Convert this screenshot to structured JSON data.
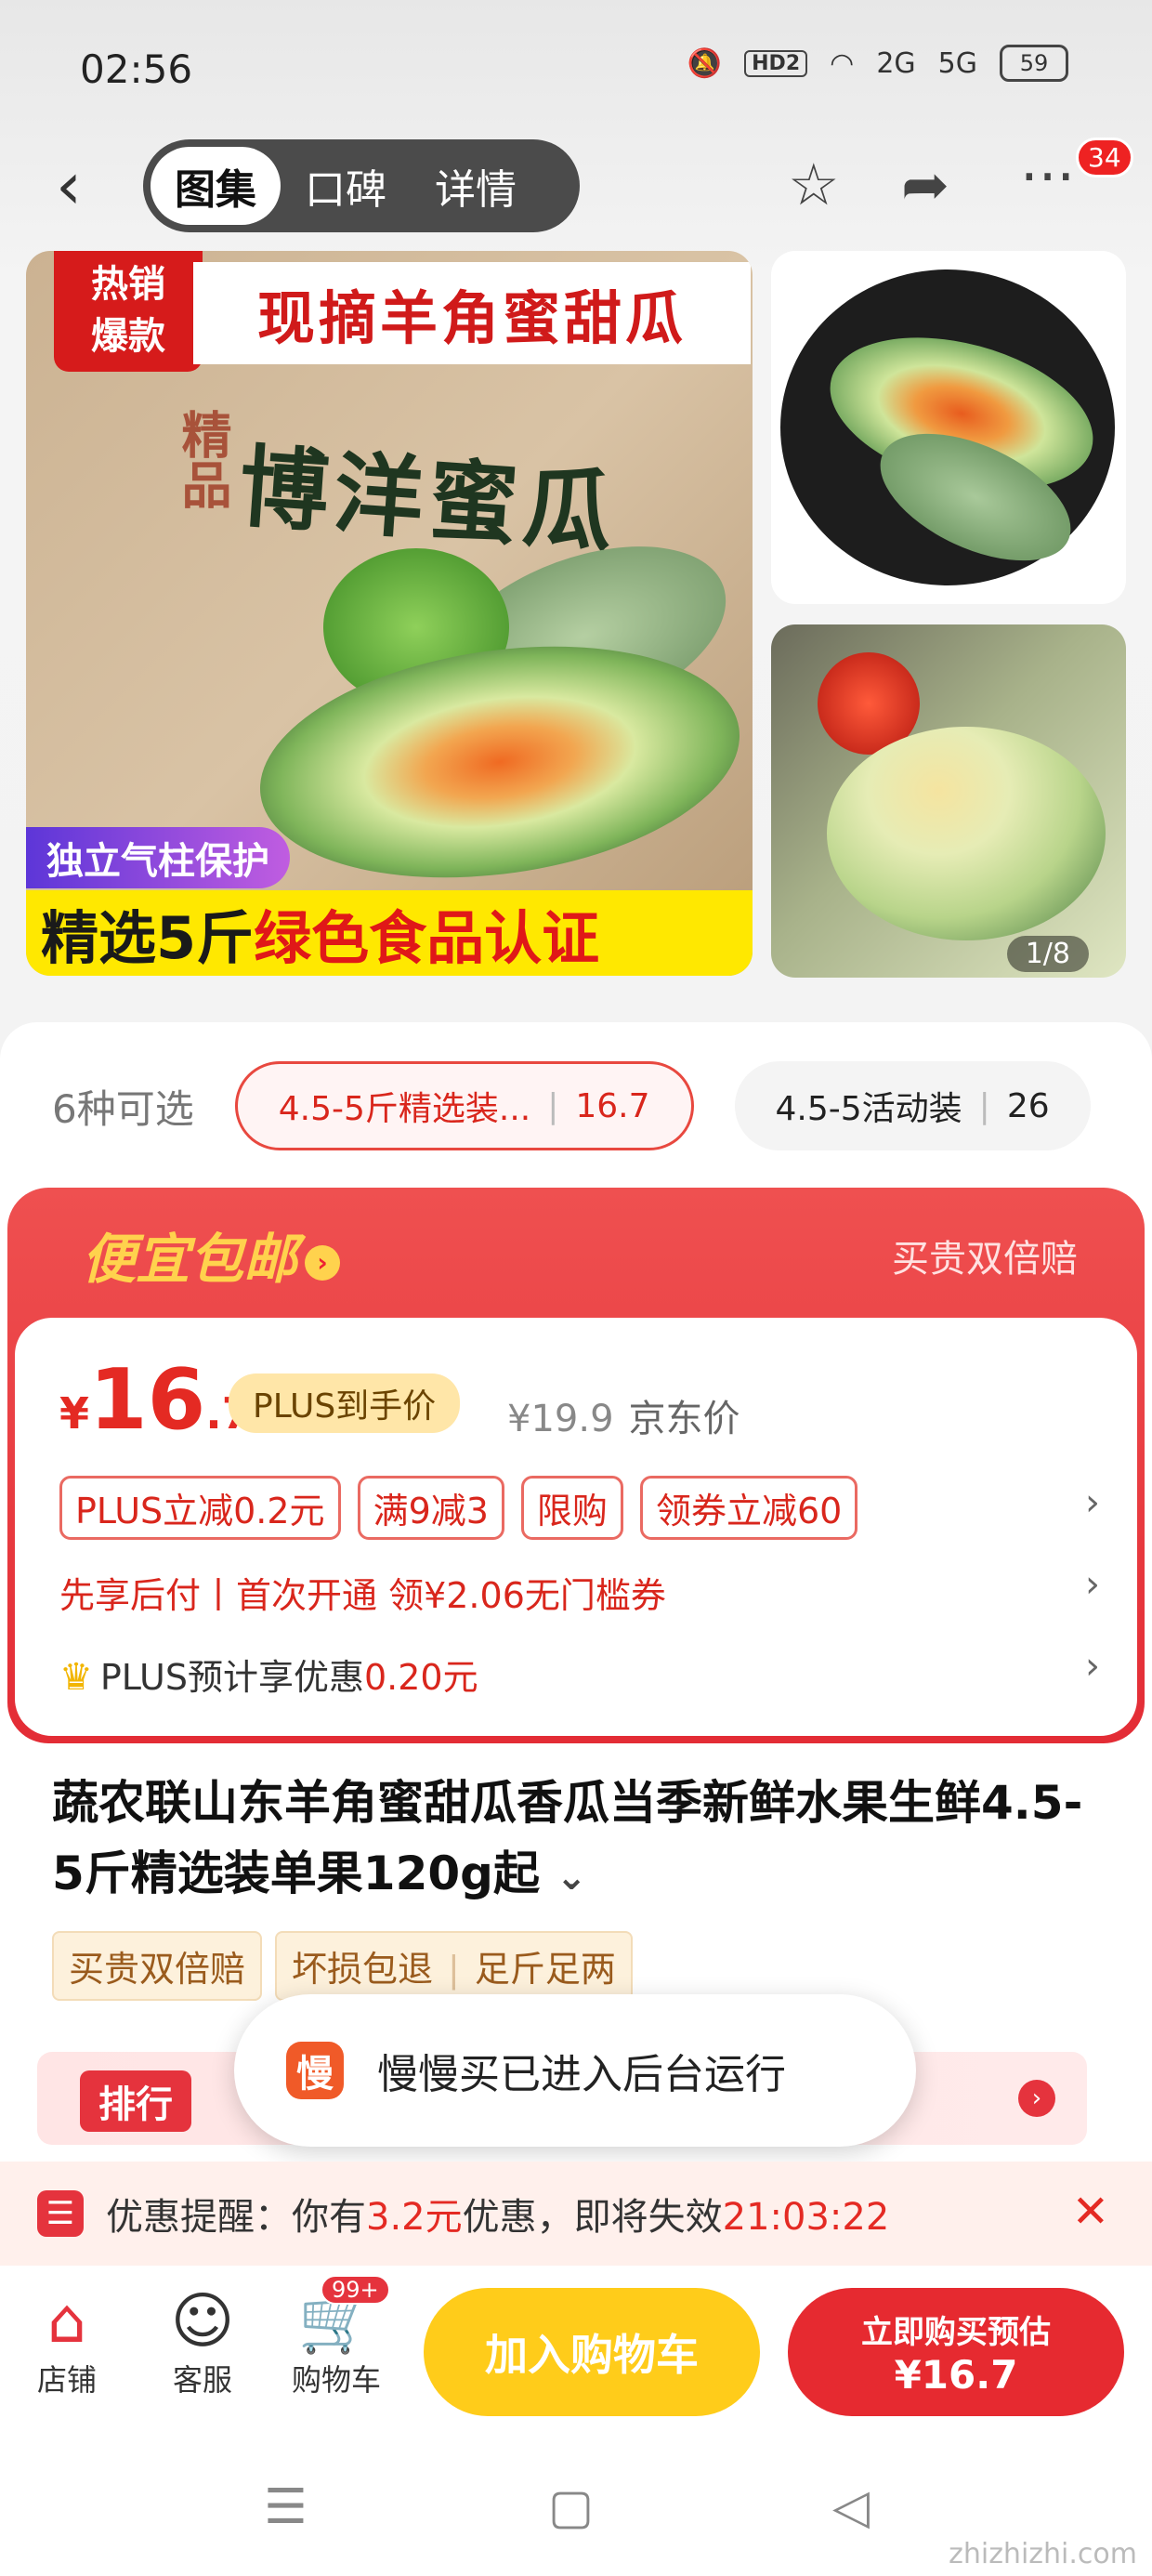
{
  "status": {
    "time": "02:56",
    "hd": "HD2",
    "signal1": "2G",
    "signal2": "5G",
    "battery": "59"
  },
  "nav": {
    "tabs": [
      "图集",
      "口碑",
      "详情"
    ],
    "active_tab": 0,
    "more_badge": "34"
  },
  "gallery": {
    "hot_label": "热销\n爆款",
    "headline": "现摘羊角蜜甜瓜",
    "box_brand": "博洋蜜瓜",
    "box_side": "精品",
    "tag_purple": "独立气柱保护",
    "tag_yellow_a": "精选5斤",
    "tag_yellow_b": "绿色食品认证",
    "pager": "1/8"
  },
  "variants": {
    "count_label": "6种可选",
    "selected_name": "4.5-5斤精选装...",
    "selected_price": "16.7",
    "other_name": "4.5-5活动装",
    "other_price": "26"
  },
  "promo": {
    "header": "便宜包邮",
    "header_right": "买贵双倍赔",
    "currency": "¥",
    "price_int": "16",
    "price_dec": ".7",
    "plus_label": "PLUS到手价",
    "jd_price": "¥19.9",
    "jd_label": "京东价",
    "chips": [
      "PLUS立减0.2元",
      "满9减3",
      "限购",
      "领券立减60"
    ],
    "row2": "先享后付丨首次开通 领¥2.06无门槛券",
    "row3_prefix": "PLUS预计享优惠",
    "row3_value": "0.20元"
  },
  "product": {
    "title": "蔬农联山东羊角蜜甜瓜香瓜当季新鲜水果生鲜4.5-5斤精选装单果120g起",
    "tags": [
      "买贵双倍赔",
      "坏损包退",
      "足斤足两"
    ],
    "rank_label": "排行"
  },
  "toast": {
    "icon": "慢",
    "text": "慢慢买已进入后台运行"
  },
  "reminder": {
    "prefix": "优惠提醒：你有",
    "amount": "3.2元",
    "middle": "优惠，即将失效",
    "countdown": "21:03:22"
  },
  "bottom": {
    "shop": "店铺",
    "service": "客服",
    "cart": "购物车",
    "cart_badge": "99+",
    "add_cart": "加入购物车",
    "buy_line1": "立即购买预估",
    "buy_line2": "¥16.7"
  },
  "watermark": "zhizhizhi.com"
}
